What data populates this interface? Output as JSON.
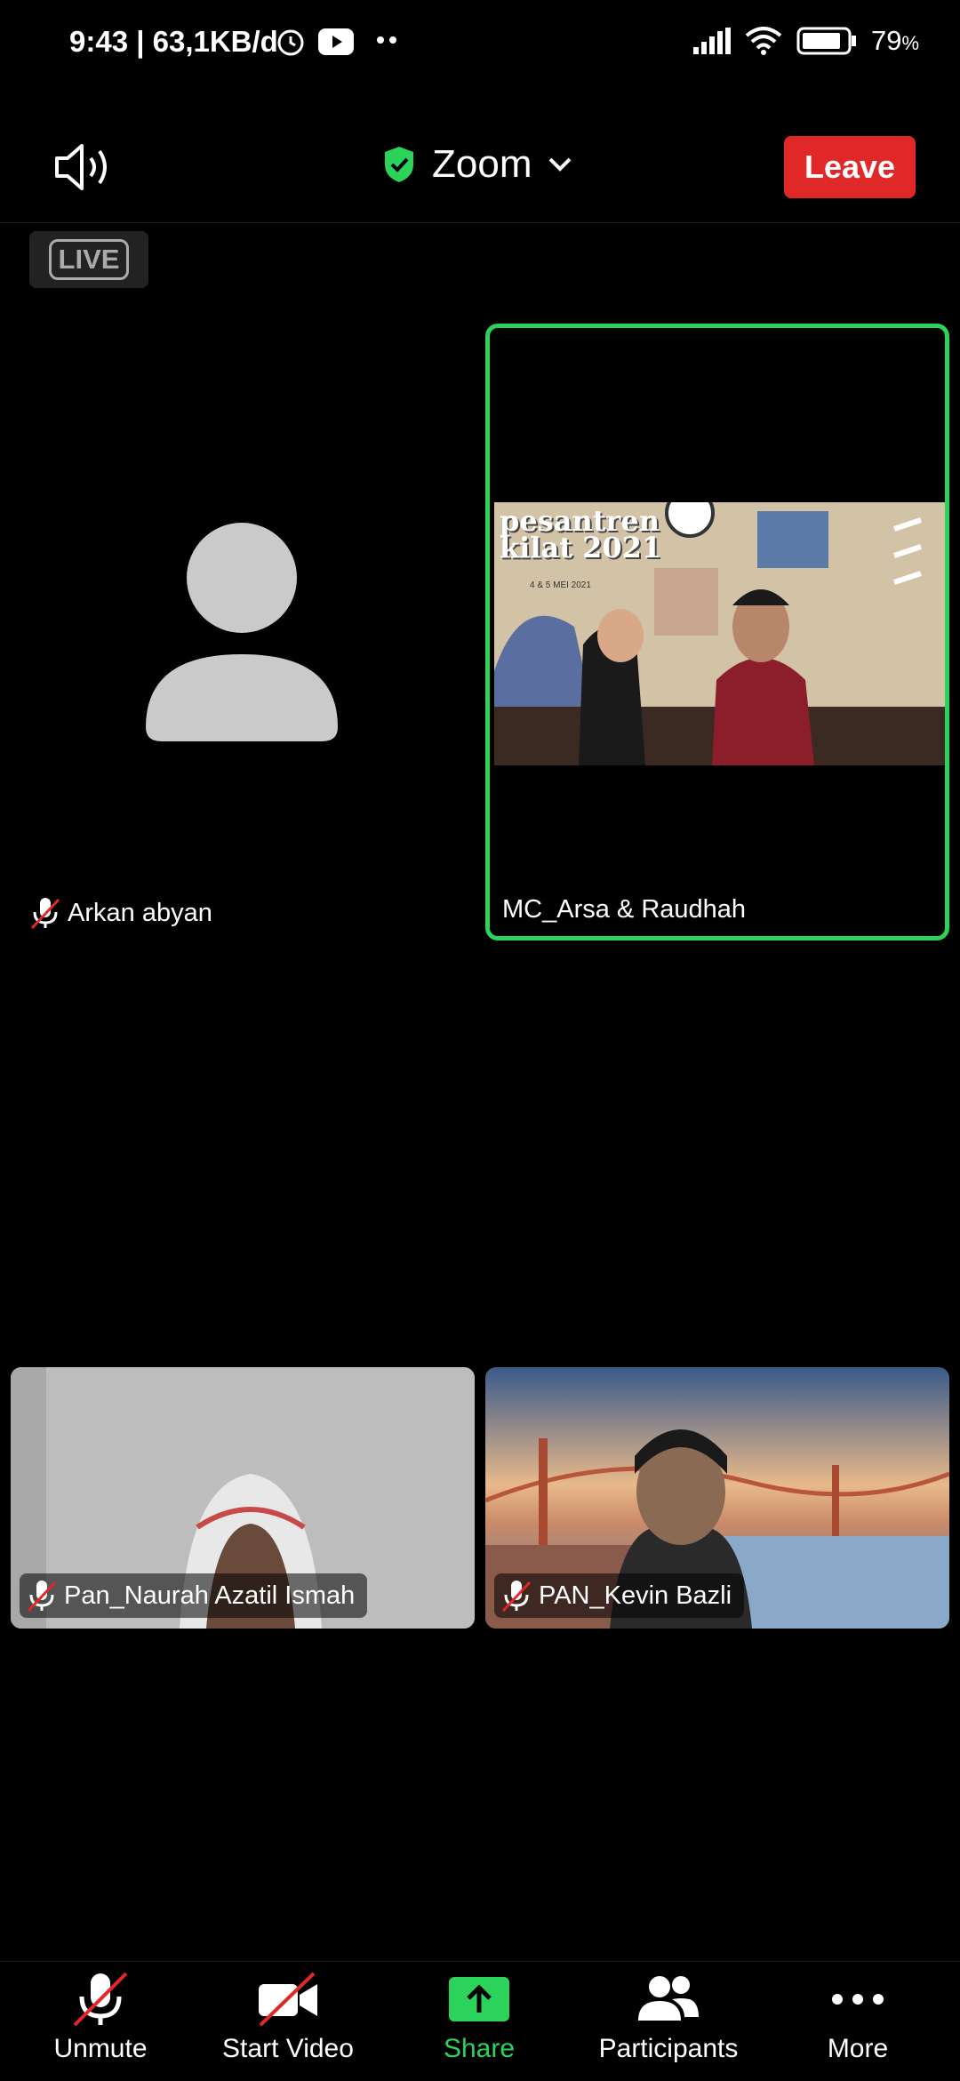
{
  "status_bar": {
    "time": "9:43 | 63,1KB/d",
    "battery": "79",
    "battery_unit": "%"
  },
  "header": {
    "title": "Zoom",
    "leave_label": "Leave",
    "live_badge": "LIVE"
  },
  "tiles": [
    {
      "name": "Arkan abyan",
      "muted": true,
      "video": false
    },
    {
      "name": "MC_Arsa & Raudhah",
      "muted": false,
      "video": true,
      "active_speaker": true
    },
    {
      "name": "Pan_Naurah Azatil Ismah",
      "muted": true,
      "video": true
    },
    {
      "name": "PAN_Kevin Bazli",
      "muted": true,
      "video": true
    }
  ],
  "shared_content": {
    "heading": "pesantren kilat 2021",
    "date": "4 & 5 MEI 2021"
  },
  "toolbar": {
    "unmute": "Unmute",
    "start_video": "Start Video",
    "share": "Share",
    "participants": "Participants",
    "more": "More"
  },
  "colors": {
    "leave": "#e02828",
    "active_border": "#2bd35a",
    "share_accent": "#2bd35a"
  }
}
